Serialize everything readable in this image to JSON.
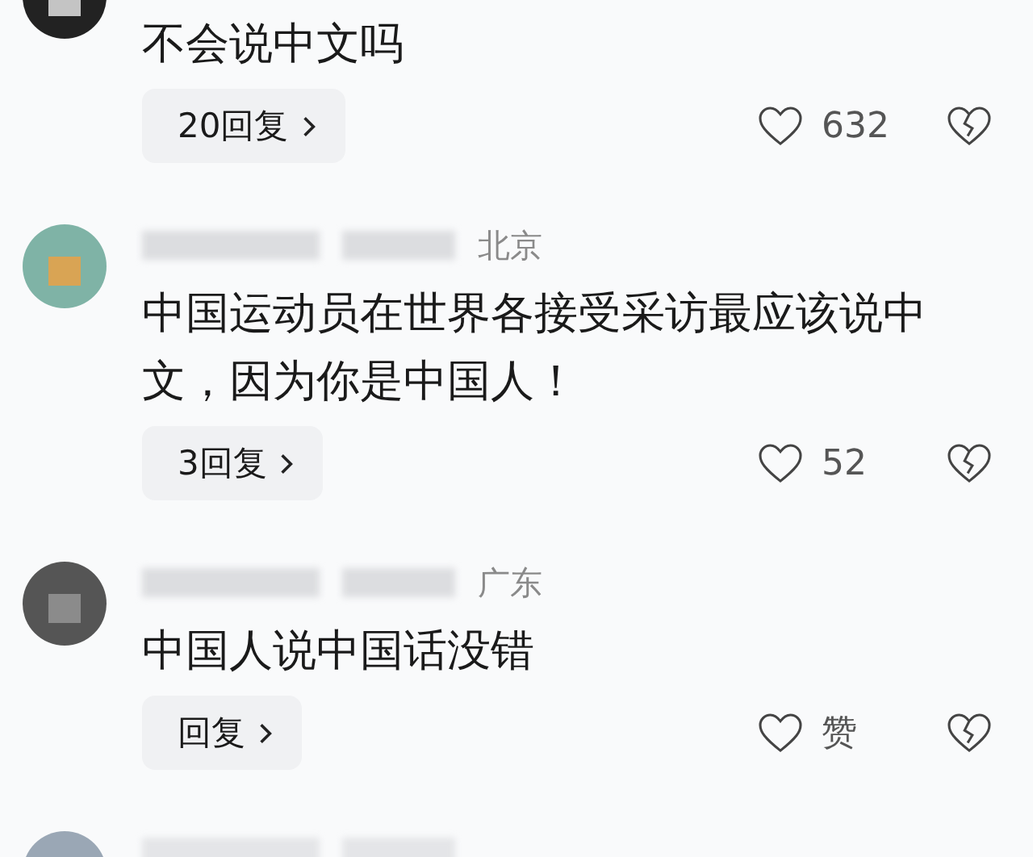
{
  "comments": [
    {
      "text": "不会说中文吗",
      "replies": "20回复",
      "likes": "632"
    },
    {
      "location": "北京",
      "text": "中国运动员在世界各接受采访最应该说中文，因为你是中国人！",
      "replies": "3回复",
      "likes": "52"
    },
    {
      "location": "广东",
      "text": "中国人说中国话没错",
      "replies": "回复",
      "likes": "赞"
    },
    {
      "kind": "cut_off"
    }
  ]
}
